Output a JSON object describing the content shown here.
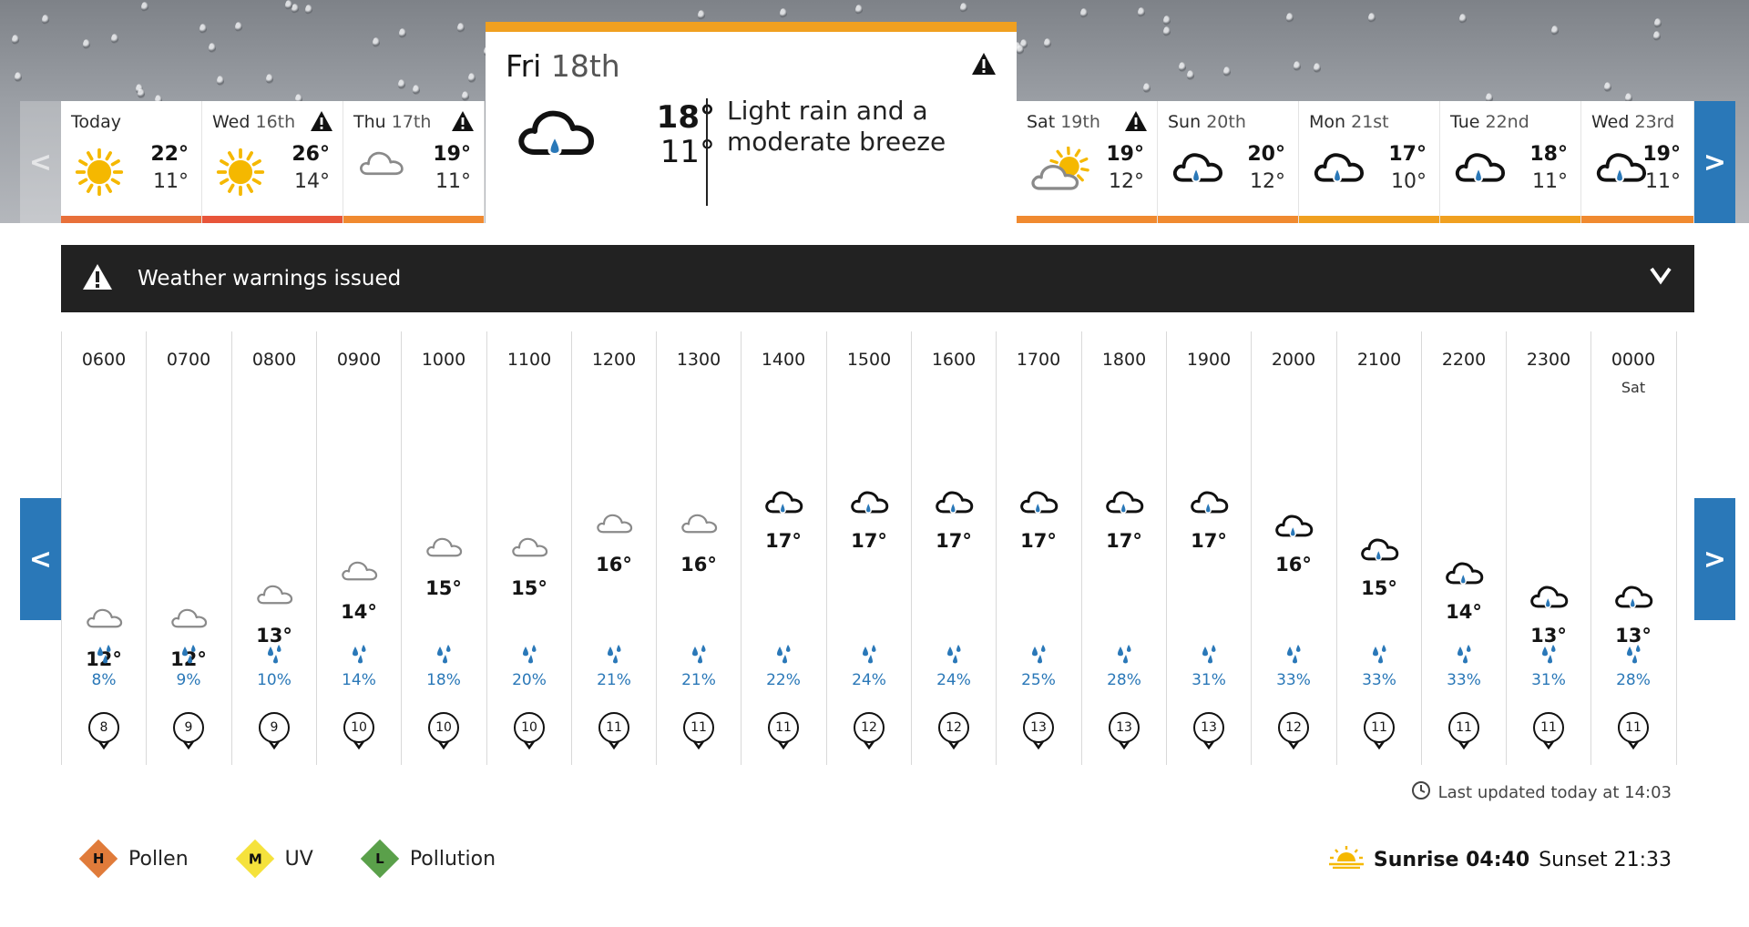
{
  "colors": {
    "accent": "#2a78b8",
    "warning_bar": "#222222",
    "temp_hot": "#e8553a",
    "temp_warm": "#f0a020",
    "rain_blue": "#2a78b8",
    "pollen_high": "#e07b3a",
    "uv_moderate": "#f5e23c",
    "pollution_low": "#5aa04a"
  },
  "day_nav": {
    "prev_label": "<",
    "next_label": ">",
    "days": [
      {
        "name": "Today",
        "date": "",
        "max": "22°",
        "min": "11°",
        "icon": "sun-icon",
        "warning": false,
        "bar_color": "#e8703a"
      },
      {
        "name": "Wed",
        "date": "16th",
        "max": "26°",
        "min": "14°",
        "icon": "sun-icon",
        "warning": true,
        "bar_color": "#e8553a"
      },
      {
        "name": "Thu",
        "date": "17th",
        "max": "19°",
        "min": "11°",
        "icon": "cloud-icon",
        "warning": true,
        "bar_color": "#f08a30"
      },
      {
        "name": "Sat",
        "date": "19th",
        "max": "19°",
        "min": "12°",
        "icon": "sunny-intervals-icon",
        "warning": true,
        "bar_color": "#f08a30"
      },
      {
        "name": "Sun",
        "date": "20th",
        "max": "20°",
        "min": "12°",
        "icon": "light-rain-icon",
        "warning": false,
        "bar_color": "#f08a30"
      },
      {
        "name": "Mon",
        "date": "21st",
        "max": "17°",
        "min": "10°",
        "icon": "light-rain-icon",
        "warning": false,
        "bar_color": "#f0a020"
      },
      {
        "name": "Tue",
        "date": "22nd",
        "max": "18°",
        "min": "11°",
        "icon": "light-rain-icon",
        "warning": false,
        "bar_color": "#f0a020"
      },
      {
        "name": "Wed",
        "date": "23rd",
        "max": "19°",
        "min": "11°",
        "icon": "light-rain-icon",
        "warning": false,
        "bar_color": "#f08a30"
      }
    ],
    "selected": {
      "name": "Fri",
      "date": "18th",
      "max": "18°",
      "min": "11°",
      "description": "Light rain and a moderate breeze",
      "icon": "light-rain-icon",
      "warning": true
    }
  },
  "warnings": {
    "label": "Weather warnings issued"
  },
  "hourly": {
    "prev_label": "<",
    "next_label": ">",
    "hours": [
      {
        "time": "0600",
        "day": "",
        "temp": "12°",
        "icon": "cloud-icon",
        "rain": "8%",
        "wind": "8"
      },
      {
        "time": "0700",
        "day": "",
        "temp": "12°",
        "icon": "cloud-icon",
        "rain": "9%",
        "wind": "9"
      },
      {
        "time": "0800",
        "day": "",
        "temp": "13°",
        "icon": "cloud-icon",
        "rain": "10%",
        "wind": "9"
      },
      {
        "time": "0900",
        "day": "",
        "temp": "14°",
        "icon": "cloud-icon",
        "rain": "14%",
        "wind": "10"
      },
      {
        "time": "1000",
        "day": "",
        "temp": "15°",
        "icon": "cloud-icon",
        "rain": "18%",
        "wind": "10"
      },
      {
        "time": "1100",
        "day": "",
        "temp": "15°",
        "icon": "cloud-icon",
        "rain": "20%",
        "wind": "10"
      },
      {
        "time": "1200",
        "day": "",
        "temp": "16°",
        "icon": "cloud-icon",
        "rain": "21%",
        "wind": "11"
      },
      {
        "time": "1300",
        "day": "",
        "temp": "16°",
        "icon": "cloud-icon",
        "rain": "21%",
        "wind": "11"
      },
      {
        "time": "1400",
        "day": "",
        "temp": "17°",
        "icon": "light-rain-icon",
        "rain": "22%",
        "wind": "11"
      },
      {
        "time": "1500",
        "day": "",
        "temp": "17°",
        "icon": "light-rain-icon",
        "rain": "24%",
        "wind": "12"
      },
      {
        "time": "1600",
        "day": "",
        "temp": "17°",
        "icon": "light-rain-icon",
        "rain": "24%",
        "wind": "12"
      },
      {
        "time": "1700",
        "day": "",
        "temp": "17°",
        "icon": "light-rain-icon",
        "rain": "25%",
        "wind": "13"
      },
      {
        "time": "1800",
        "day": "",
        "temp": "17°",
        "icon": "light-rain-icon",
        "rain": "28%",
        "wind": "13"
      },
      {
        "time": "1900",
        "day": "",
        "temp": "17°",
        "icon": "light-rain-icon",
        "rain": "31%",
        "wind": "13"
      },
      {
        "time": "2000",
        "day": "",
        "temp": "16°",
        "icon": "light-rain-icon",
        "rain": "33%",
        "wind": "12"
      },
      {
        "time": "2100",
        "day": "",
        "temp": "15°",
        "icon": "light-rain-icon",
        "rain": "33%",
        "wind": "11"
      },
      {
        "time": "2200",
        "day": "",
        "temp": "14°",
        "icon": "light-rain-icon",
        "rain": "33%",
        "wind": "11"
      },
      {
        "time": "2300",
        "day": "",
        "temp": "13°",
        "icon": "light-rain-icon",
        "rain": "31%",
        "wind": "11"
      },
      {
        "time": "0000",
        "day": "Sat",
        "temp": "13°",
        "icon": "light-rain-icon",
        "rain": "28%",
        "wind": "11"
      }
    ]
  },
  "last_updated": "Last updated today at 14:03",
  "legend": [
    {
      "letter": "H",
      "label": "Pollen",
      "color": "#e07b3a"
    },
    {
      "letter": "M",
      "label": "UV",
      "color": "#f5e23c"
    },
    {
      "letter": "L",
      "label": "Pollution",
      "color": "#5aa04a"
    }
  ],
  "sun": {
    "sunrise": "Sunrise 04:40",
    "sunset": "Sunset 21:33"
  }
}
